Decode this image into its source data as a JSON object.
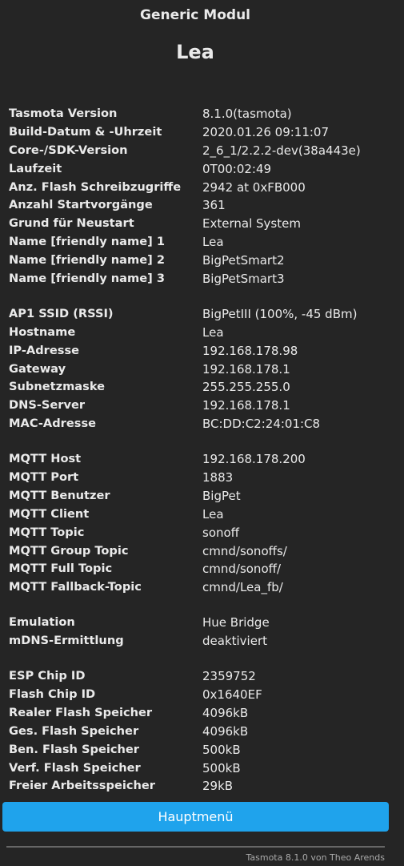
{
  "header": {
    "module": "Generic Modul",
    "device": "Lea"
  },
  "sections": [
    [
      [
        "Tasmota Version",
        "8.1.0(tasmota)"
      ],
      [
        "Build-Datum & -Uhrzeit",
        "2020.01.26 09:11:07"
      ],
      [
        "Core-/SDK-Version",
        "2_6_1/2.2.2-dev(38a443e)"
      ],
      [
        "Laufzeit",
        "0T00:02:49"
      ],
      [
        "Anz. Flash Schreibzugriffe",
        "2942 at 0xFB000"
      ],
      [
        "Anzahl Startvorgänge",
        "361"
      ],
      [
        "Grund für Neustart",
        "External System"
      ],
      [
        "Name [friendly name] 1",
        "Lea"
      ],
      [
        "Name [friendly name] 2",
        "BigPetSmart2"
      ],
      [
        "Name [friendly name] 3",
        "BigPetSmart3"
      ]
    ],
    [
      [
        "AP1 SSID (RSSI)",
        "BigPetIII (100%, -45 dBm)"
      ],
      [
        "Hostname",
        "Lea"
      ],
      [
        "IP-Adresse",
        "192.168.178.98"
      ],
      [
        "Gateway",
        "192.168.178.1"
      ],
      [
        "Subnetzmaske",
        "255.255.255.0"
      ],
      [
        "DNS-Server",
        "192.168.178.1"
      ],
      [
        "MAC-Adresse",
        "BC:DD:C2:24:01:C8"
      ]
    ],
    [
      [
        "MQTT Host",
        "192.168.178.200"
      ],
      [
        "MQTT Port",
        "1883"
      ],
      [
        "MQTT Benutzer",
        "BigPet"
      ],
      [
        "MQTT Client",
        "Lea"
      ],
      [
        "MQTT Topic",
        "sonoff"
      ],
      [
        "MQTT Group Topic",
        "cmnd/sonoffs/"
      ],
      [
        "MQTT Full Topic",
        "cmnd/sonoff/"
      ],
      [
        "MQTT Fallback-Topic",
        "cmnd/Lea_fb/"
      ]
    ],
    [
      [
        "Emulation",
        "Hue Bridge"
      ],
      [
        "mDNS-Ermittlung",
        "deaktiviert"
      ]
    ],
    [
      [
        "ESP Chip ID",
        "2359752"
      ],
      [
        "Flash Chip ID",
        "0x1640EF"
      ],
      [
        "Realer Flash Speicher",
        "4096kB"
      ],
      [
        "Ges. Flash Speicher",
        "4096kB"
      ],
      [
        "Ben. Flash Speicher",
        "500kB"
      ],
      [
        "Verf. Flash Speicher",
        "500kB"
      ],
      [
        "Freier Arbeitsspeicher",
        "29kB"
      ]
    ]
  ],
  "main_menu_button": "Hauptmenü",
  "footer": "Tasmota 8.1.0 von Theo Arends",
  "colors": {
    "background": "#252525",
    "text": "#eaeaea",
    "button": "#1fa3ec"
  }
}
